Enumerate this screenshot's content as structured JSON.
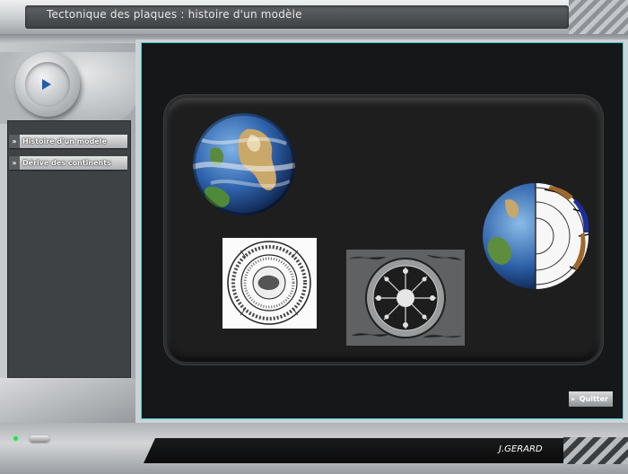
{
  "window": {
    "title": "Tectonique des plaques : histoire d'un modèle"
  },
  "sidebar": {
    "items": [
      {
        "label": "Histoire d'un modèle"
      },
      {
        "label": "Dérive des continents"
      }
    ]
  },
  "main": {
    "quit_label": "Quitter"
  },
  "footer": {
    "author": "J.GERARD"
  },
  "icons": {
    "play": "play-icon",
    "chevron": "double-chevron-right-icon"
  },
  "colors": {
    "screen_border": "#3dd1d4",
    "play_icon": "#1f5fae",
    "led": "#23e05a"
  }
}
